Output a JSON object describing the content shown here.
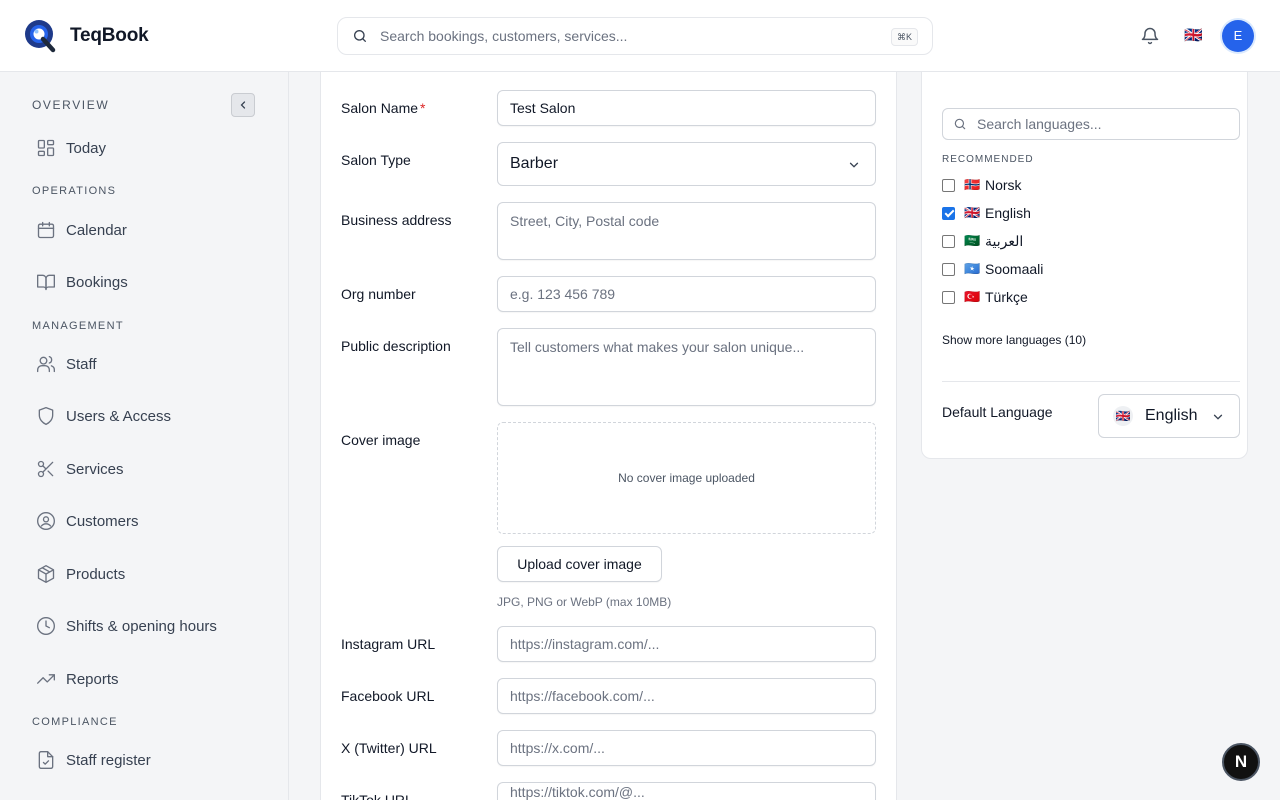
{
  "app": {
    "name": "TeqBook"
  },
  "header": {
    "search_placeholder": "Search bookings, customers, services...",
    "shortcut": "⌘K",
    "language_flag": "🇬🇧",
    "avatar_initial": "E"
  },
  "sidebar": {
    "overview_title": "OVERVIEW",
    "sections": {
      "operations": "OPERATIONS",
      "management": "MANAGEMENT",
      "compliance": "COMPLIANCE"
    },
    "items": [
      {
        "label": "Today",
        "icon": "dashboard-icon"
      },
      {
        "label": "Calendar",
        "icon": "calendar-icon"
      },
      {
        "label": "Bookings",
        "icon": "book-open-icon"
      },
      {
        "label": "Staff",
        "icon": "users-icon"
      },
      {
        "label": "Users & Access",
        "icon": "shield-icon"
      },
      {
        "label": "Services",
        "icon": "scissors-icon"
      },
      {
        "label": "Customers",
        "icon": "user-circle-icon"
      },
      {
        "label": "Products",
        "icon": "package-icon"
      },
      {
        "label": "Shifts & opening hours",
        "icon": "clock-icon"
      },
      {
        "label": "Reports",
        "icon": "trending-up-icon"
      },
      {
        "label": "Staff register",
        "icon": "file-check-icon"
      }
    ]
  },
  "form": {
    "salon_name": {
      "label": "Salon Name",
      "required_mark": "*",
      "value": "Test Salon"
    },
    "salon_type": {
      "label": "Salon Type",
      "value": "Barber"
    },
    "business_address": {
      "label": "Business address",
      "placeholder": "Street, City, Postal code"
    },
    "org_number": {
      "label": "Org number",
      "placeholder": "e.g. 123 456 789"
    },
    "public_description": {
      "label": "Public description",
      "placeholder": "Tell customers what makes your salon unique..."
    },
    "cover_image": {
      "label": "Cover image",
      "empty_text": "No cover image uploaded",
      "upload_label": "Upload cover image",
      "hint": "JPG, PNG or WebP (max 10MB)"
    },
    "instagram": {
      "label": "Instagram URL",
      "placeholder": "https://instagram.com/..."
    },
    "facebook": {
      "label": "Facebook URL",
      "placeholder": "https://facebook.com/..."
    },
    "twitter": {
      "label": "X (Twitter) URL",
      "placeholder": "https://x.com/..."
    },
    "tiktok": {
      "label": "TikTok URL",
      "placeholder": "https://tiktok.com/@..."
    }
  },
  "languages": {
    "search_placeholder": "Search languages...",
    "recommended_title": "RECOMMENDED",
    "items": [
      {
        "flag": "🇳🇴",
        "name": "Norsk",
        "checked": false
      },
      {
        "flag": "🇬🇧",
        "name": "English",
        "checked": true
      },
      {
        "flag": "🇸🇦",
        "name": "العربية",
        "checked": false
      },
      {
        "flag": "🇸🇴",
        "name": "Soomaali",
        "checked": false
      },
      {
        "flag": "🇹🇷",
        "name": "Türkçe",
        "checked": false
      }
    ],
    "show_more": "Show more languages (10)",
    "default_label": "Default Language",
    "default_value": "English",
    "default_flag": "🇬🇧"
  },
  "dev_badge": "N",
  "colors": {
    "accent": "#2563eb",
    "required": "#dc2626",
    "checkbox": "#1a73e8"
  }
}
